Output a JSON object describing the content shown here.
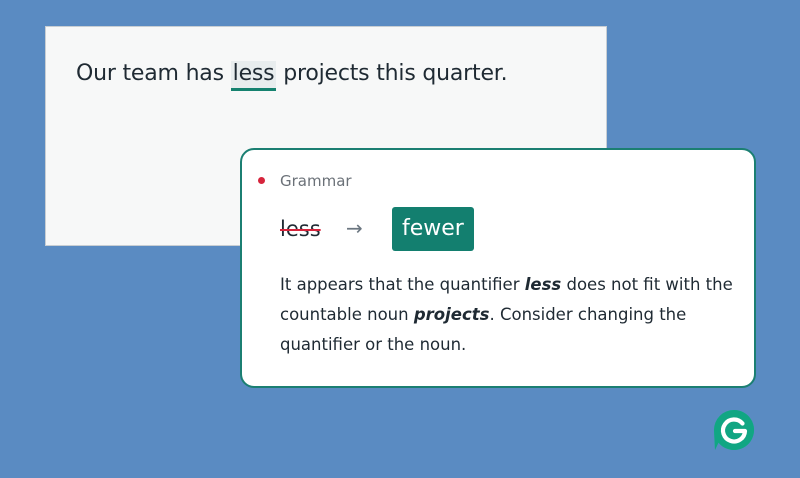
{
  "document": {
    "sentence_before": "Our team has ",
    "flagged_word": "less",
    "sentence_after": " projects this quarter."
  },
  "card": {
    "category": "Grammar",
    "original": "less",
    "arrow": "→",
    "suggestion": "fewer",
    "explanation": {
      "part1": "It appears that the quantifier ",
      "em1": "less",
      "part2": " does not fit with the countable noun ",
      "em2": "projects",
      "part3": ". Consider changing the quantifier or the noun."
    }
  },
  "colors": {
    "background": "#5a8bc2",
    "accent": "#137f6f",
    "error_dot": "#d6243c"
  },
  "icons": {
    "logo": "grammarly-logo-icon",
    "arrow": "right-arrow-icon",
    "dot": "alert-dot-icon"
  }
}
